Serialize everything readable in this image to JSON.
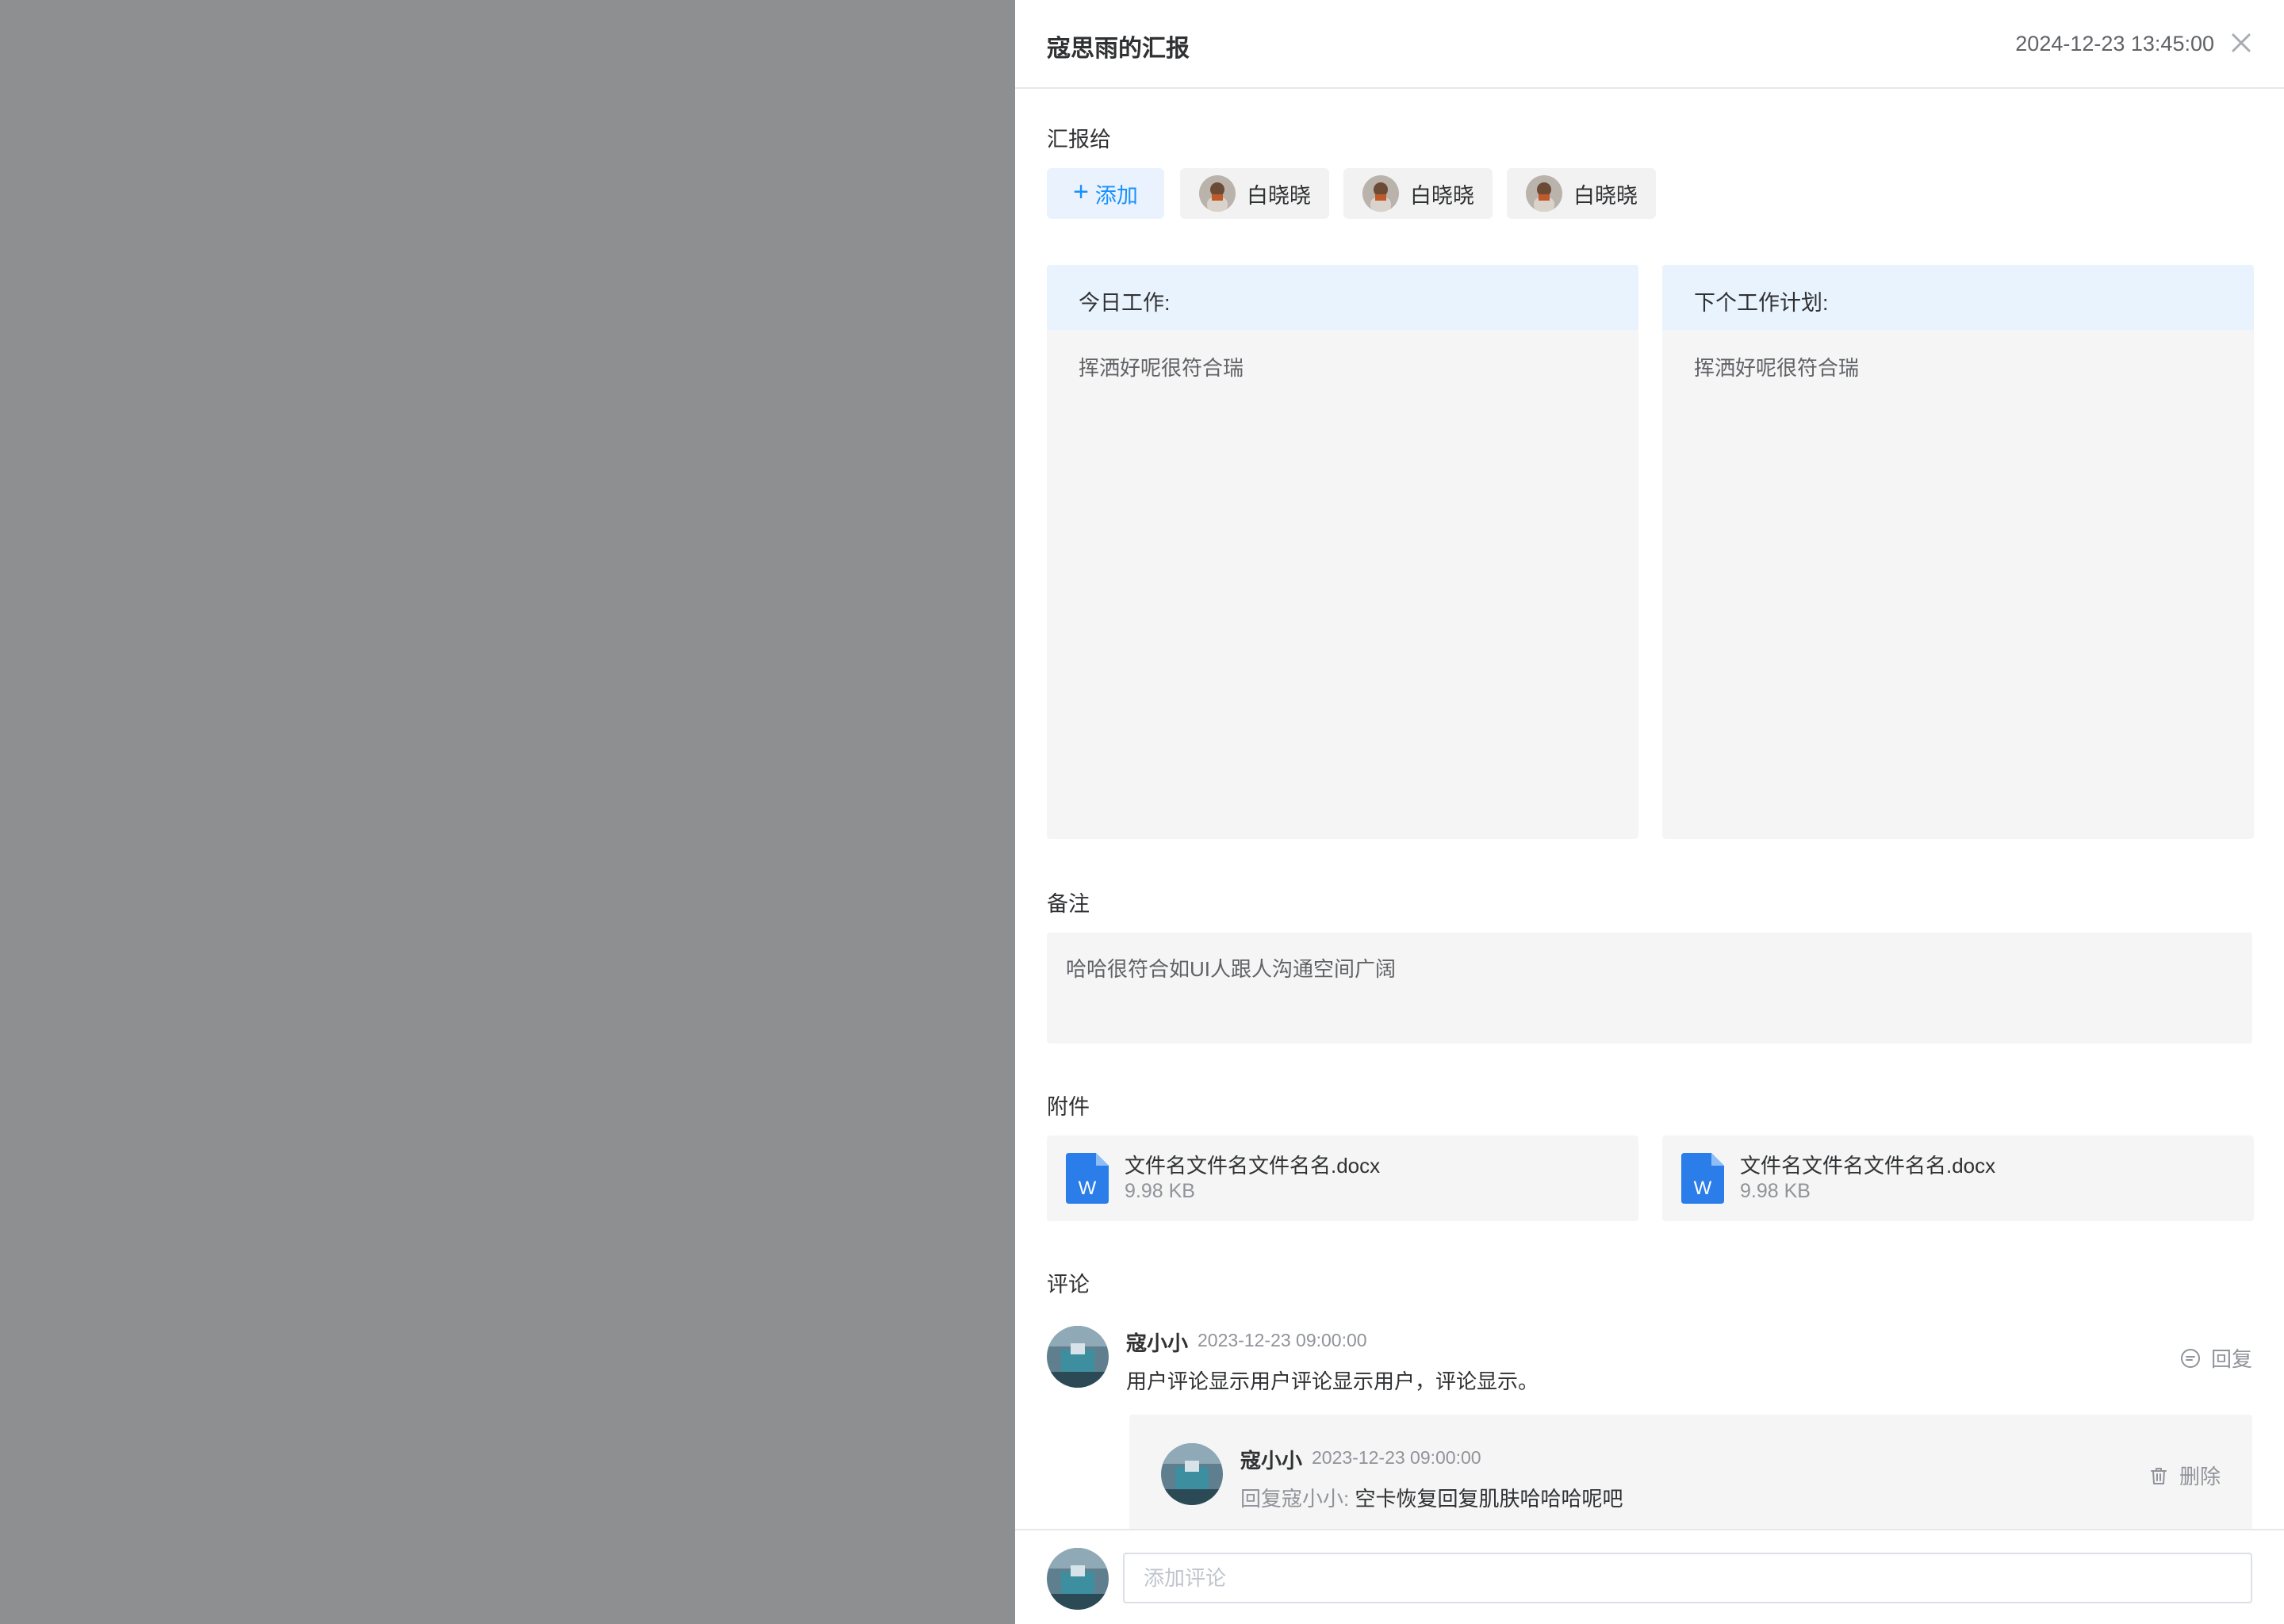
{
  "header": {
    "title": "寇思雨的汇报",
    "time": "2024-12-23 13:45:00",
    "close_icon": "close-icon"
  },
  "report_to": {
    "label": "汇报给",
    "add_label": "添加",
    "recipients": [
      {
        "name": "白晓晓"
      },
      {
        "name": "白晓晓"
      },
      {
        "name": "白晓晓"
      }
    ]
  },
  "today_work": {
    "title": "今日工作:",
    "content": "挥洒好呢很符合瑞"
  },
  "next_plan": {
    "title": "下个工作计划:",
    "content": "挥洒好呢很符合瑞"
  },
  "remark": {
    "label": "备注",
    "content": "哈哈很符合如UI人跟人沟通空间广阔"
  },
  "attachments": {
    "label": "附件",
    "files": [
      {
        "name": "文件名文件名文件名名.docx",
        "size": "9.98 KB",
        "icon": "word-file-icon"
      },
      {
        "name": "文件名文件名文件名名.docx",
        "size": "9.98 KB",
        "icon": "word-file-icon"
      }
    ]
  },
  "comments": {
    "label": "评论",
    "items": [
      {
        "author": "寇小小",
        "time": "2023-12-23 09:00:00",
        "text": "用户评论显示用户评论显示用户，评论显示。",
        "action_label": "回复",
        "replies": [
          {
            "author": "寇小小",
            "time": "2023-12-23 09:00:00",
            "reply_prefix": "回复寇小小:",
            "text": "空卡恢复回复肌肤哈哈哈呢吧",
            "action_label": "删除"
          }
        ]
      }
    ]
  },
  "footer": {
    "comment_placeholder": "添加评论"
  },
  "colors": {
    "accent": "#1890ff",
    "overlay": "#8e8f91",
    "panel_head": "#e9f3fd",
    "panel_bg": "#f5f5f5",
    "word_icon": "#2b7de9"
  }
}
